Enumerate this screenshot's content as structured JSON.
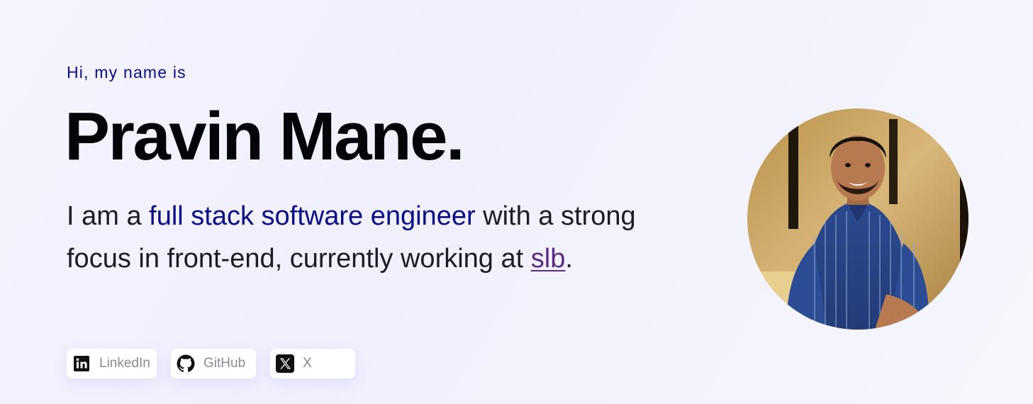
{
  "hero": {
    "greeting": "Hi, my name is",
    "name": "Pravin Mane.",
    "intro_part1": "I am a ",
    "intro_highlight": "full stack software engineer",
    "intro_part2": " with a strong focus in front-end, currently working at ",
    "company_link": "slb",
    "intro_end": "."
  },
  "socials": [
    {
      "label": "LinkedIn",
      "icon": "linkedin-icon"
    },
    {
      "label": "GitHub",
      "icon": "github-icon"
    },
    {
      "label": "X",
      "icon": "x-icon"
    }
  ],
  "avatar": {
    "icon": "profile-photo"
  },
  "colors": {
    "accent": "#0c0c86",
    "link": "#5b2a86",
    "heading": "#050509",
    "background": "#f2f2fd"
  }
}
